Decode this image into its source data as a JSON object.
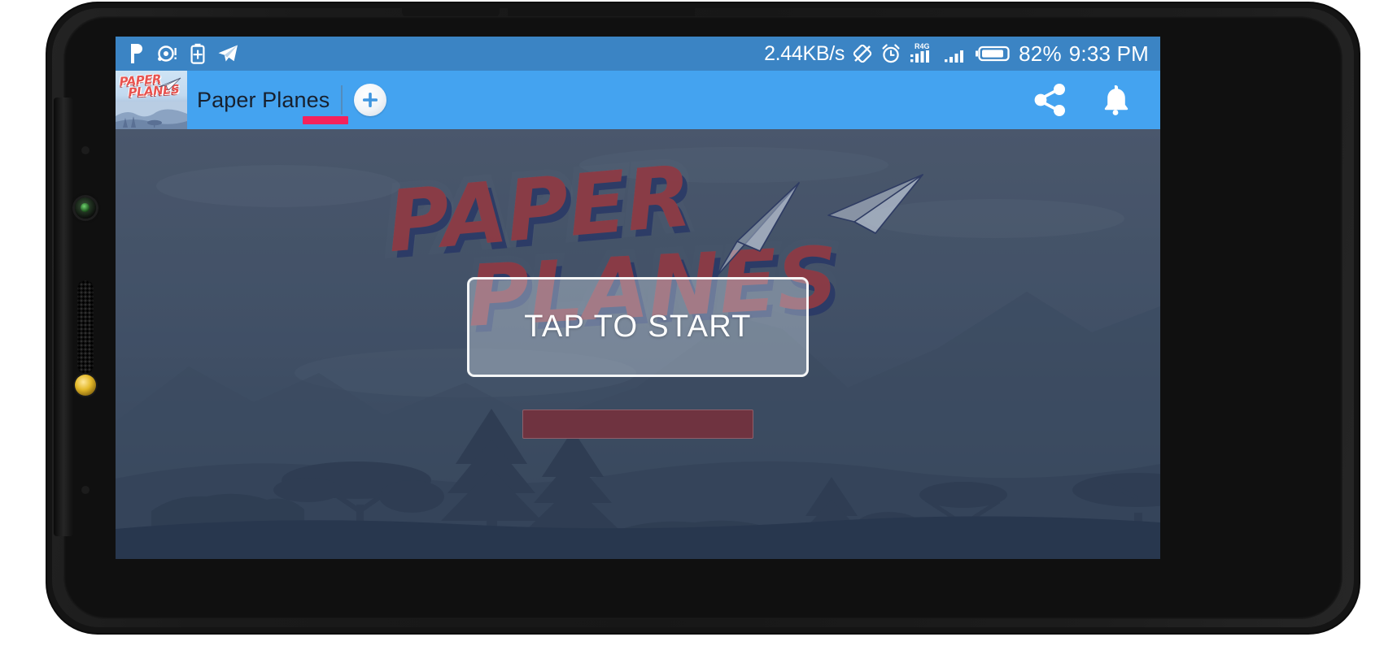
{
  "device": {
    "frame": "android-phone-landscape",
    "bezel_components": [
      "camera-lens",
      "speaker-grille",
      "gold-sensor"
    ]
  },
  "status_bar": {
    "background": "#3b84c4",
    "foreground": "#ffffff",
    "left_icons": [
      {
        "name": "pushbullet-icon",
        "glyph": "P"
      },
      {
        "name": "disc-notification-icon",
        "glyph": "◉"
      },
      {
        "name": "battery-plus-icon",
        "glyph": "ὐb"
      },
      {
        "name": "telegram-icon",
        "glyph": "➤"
      }
    ],
    "network_speed": "2.44KB/s",
    "right_icons": [
      {
        "name": "rotation-locked-icon"
      },
      {
        "name": "alarm-icon"
      },
      {
        "name": "signal-sim1-icon",
        "network_label": "R4G"
      },
      {
        "name": "signal-sim2-icon"
      },
      {
        "name": "battery-icon"
      }
    ],
    "battery_percent": "82%",
    "time": "9:33 PM"
  },
  "app_bar": {
    "background": "#44a3f0",
    "thumbnail": {
      "name": "paper-planes-app-thumbnail",
      "logo_line1": "PAPER",
      "logo_line2": "PLANES"
    },
    "title": "Paper Planes",
    "tab_indicator_color": "#f4225c",
    "add_button_label": "+",
    "actions": [
      {
        "name": "share-icon",
        "label": "Share"
      },
      {
        "name": "notification-bell-icon",
        "label": "Notifications"
      }
    ]
  },
  "game": {
    "title_line1": "PAPER",
    "title_line2": "PLANES",
    "title_fill": "#8f3a44",
    "title_shadow": "#2b3a66",
    "background_top": "#5a6b81",
    "background_bottom": "#3c4c62",
    "start_button_label": "TAP TO START",
    "start_button_border": "#ffffff",
    "ad_banner": {
      "name": "ad-banner-placeholder",
      "color": "#6f3340",
      "label": ""
    },
    "scenery": [
      "acacia-tree",
      "pine-tree",
      "mountain",
      "rock",
      "cloud"
    ]
  }
}
